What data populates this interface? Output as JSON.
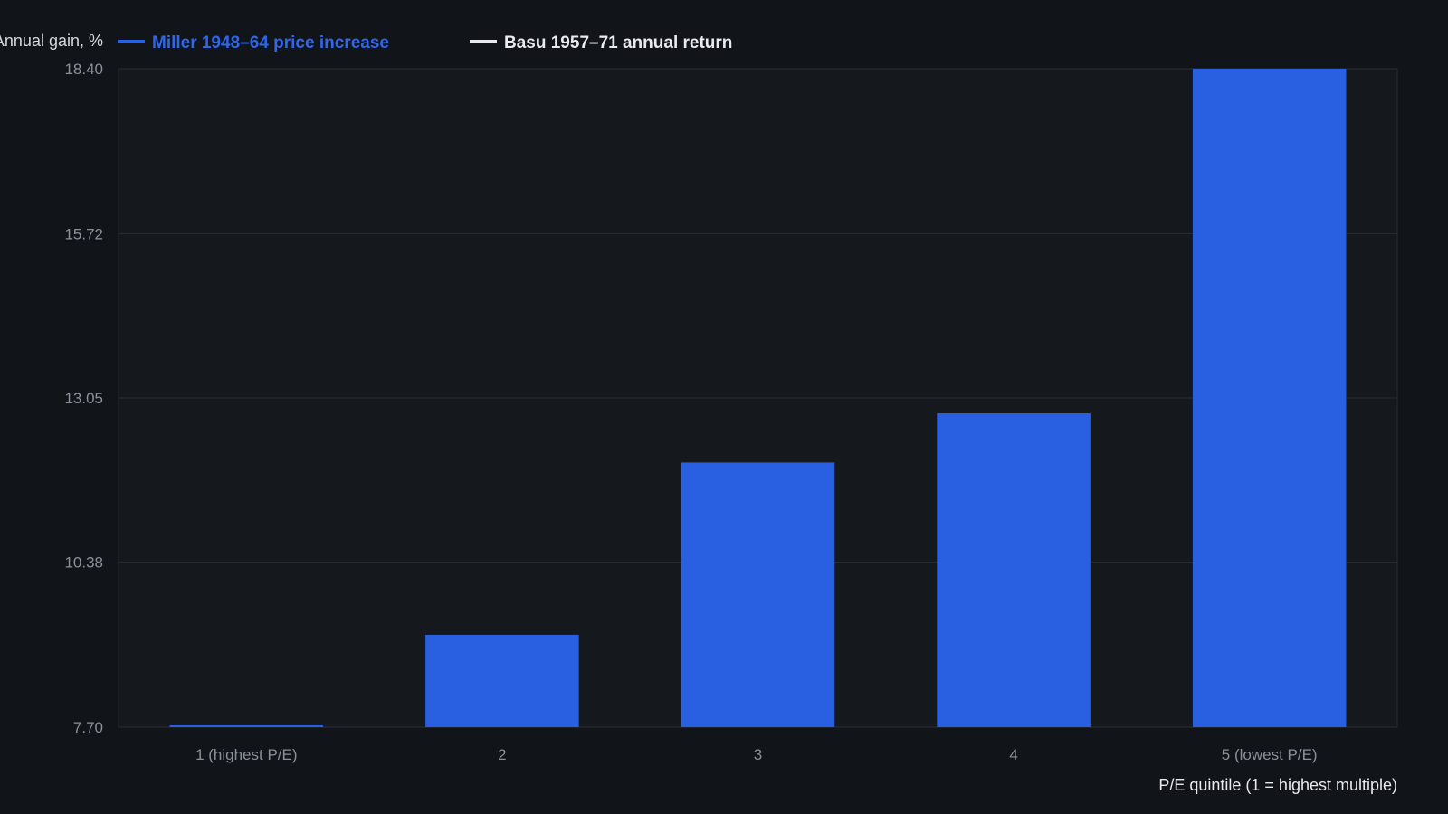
{
  "chart_data": {
    "type": "bar",
    "ylabel": "Annual gain, %",
    "xlabel": "P/E quintile (1 = highest multiple)",
    "categories": [
      "1 (highest P/E)",
      "2",
      "3",
      "4",
      "5 (lowest P/E)"
    ],
    "series": [
      {
        "name": "Miller 1948–64 price increase",
        "color": "#2860e1",
        "values": [
          7.7,
          9.2,
          12.0,
          12.8,
          18.4
        ]
      },
      {
        "name": "Basu 1957–71 annual return",
        "color": "#e8eaee",
        "values": []
      }
    ],
    "yticks": [
      "7.70",
      "10.38",
      "13.05",
      "15.72",
      "18.40"
    ],
    "ylim": [
      7.7,
      18.4
    ],
    "grid": true,
    "legend_position": "top-left"
  }
}
